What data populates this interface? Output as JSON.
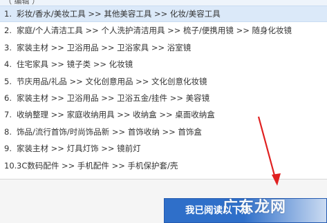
{
  "top_strip_text": "（ 编辑 ）",
  "categories": [
    {
      "num": "1.",
      "path": "彩妆/香水/美妆工具 >> 其他美容工具 >> 化妆/美容工具"
    },
    {
      "num": "2.",
      "path": "家庭/个人清洁工具 >> 个人洗护清洁用具 >> 梳子/便携用镜 >> 随身化妆镜"
    },
    {
      "num": "3.",
      "path": "家装主材 >> 卫浴用品 >> 卫浴家具 >> 浴室镜"
    },
    {
      "num": "4.",
      "path": "住宅家具 >> 镜子类 >> 化妆镜"
    },
    {
      "num": "5.",
      "path": "节庆用品/礼品 >> 文化创意用品 >> 文化创意化妆镜"
    },
    {
      "num": "6.",
      "path": "家装主材 >> 卫浴用品 >> 卫浴五金/挂件 >> 美容镜"
    },
    {
      "num": "7.",
      "path": "收纳整理 >> 家庭收纳用具 >> 收纳盒 >> 桌面收纳盒"
    },
    {
      "num": "8.",
      "path": "饰品/流行首饰/时尚饰品新 >> 首饰收纳 >> 首饰盒"
    },
    {
      "num": "9.",
      "path": "家装主材 >> 灯具灯饰 >> 镜前灯"
    },
    {
      "num": "10.",
      "path": "3C数码配件 >> 手机配件 >> 手机保护套/壳"
    }
  ],
  "confirm_button": {
    "label": "我已阅读以下规"
  },
  "watermark": "广东龙网",
  "colors": {
    "active_row": "#dbe9f9",
    "button": "#2f6fc9",
    "arrow": "#e02020"
  },
  "selected_index": 0
}
